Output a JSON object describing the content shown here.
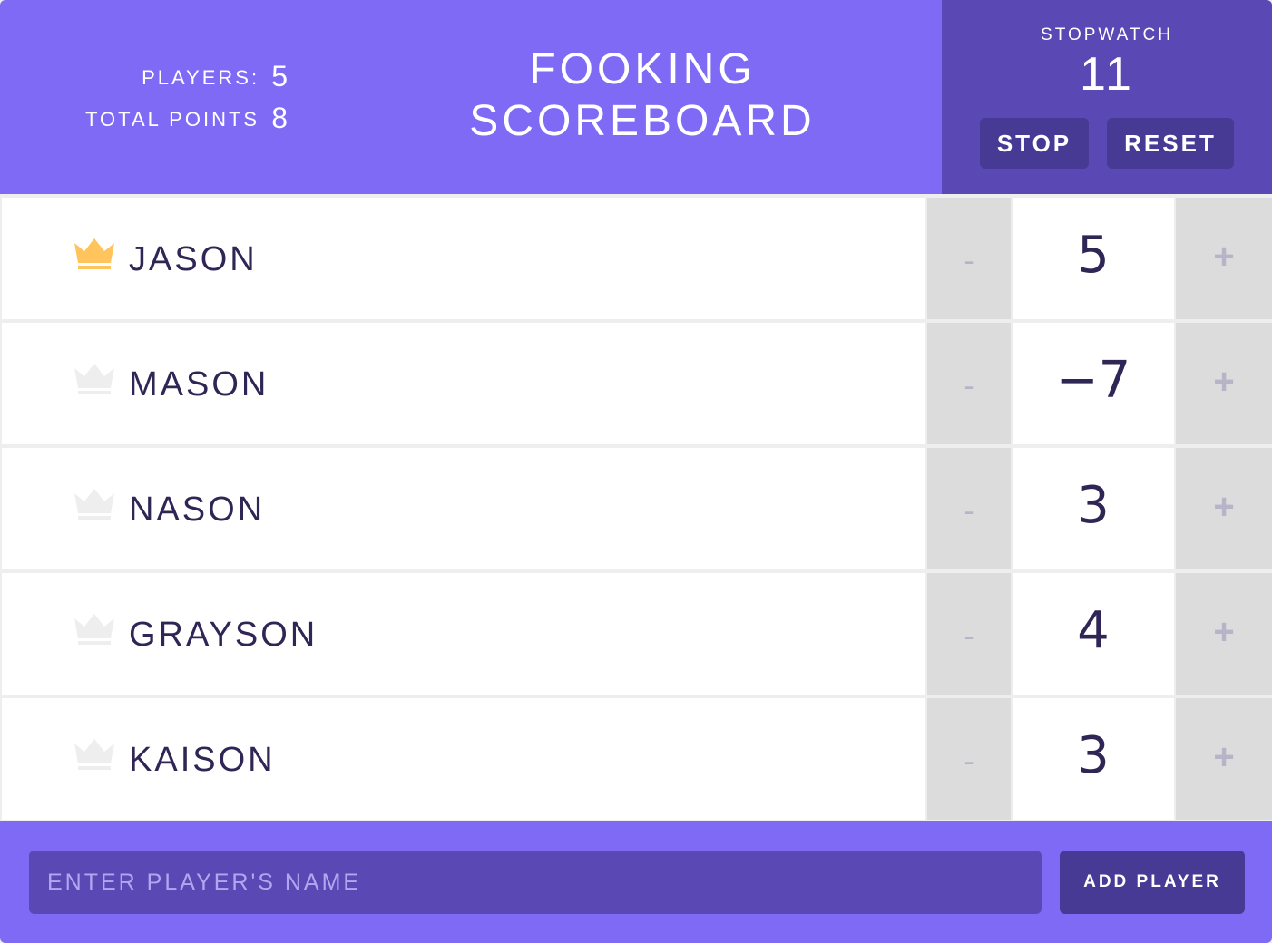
{
  "header": {
    "players_label": "PLAYERS:",
    "players_count": "5",
    "points_label": "TOTAL POINTS",
    "points_total": "8",
    "title_line1": "FOOKING",
    "title_line2": "SCOREBOARD"
  },
  "stopwatch": {
    "label": "STOPWATCH",
    "time": "11",
    "stop_label": "STOP",
    "reset_label": "RESET"
  },
  "players": [
    {
      "name": "JASON",
      "score": "5",
      "leader": true,
      "minus": "-",
      "plus": "+"
    },
    {
      "name": "MASON",
      "score": "−7",
      "leader": false,
      "minus": "-",
      "plus": "+"
    },
    {
      "name": "NASON",
      "score": "3",
      "leader": false,
      "minus": "-",
      "plus": "+"
    },
    {
      "name": "GRAYSON",
      "score": "4",
      "leader": false,
      "minus": "-",
      "plus": "+"
    },
    {
      "name": "KAISON",
      "score": "3",
      "leader": false,
      "minus": "-",
      "plus": "+"
    }
  ],
  "add_form": {
    "placeholder": "ENTER PLAYER'S NAME",
    "button_label": "ADD PLAYER"
  },
  "icons": {
    "crown": "crown-icon"
  },
  "colors": {
    "header_bg": "#7f6af5",
    "stopwatch_bg": "#5a48b5",
    "button_bg": "#463a95",
    "crown_active": "#ffc55c",
    "crown_inactive": "#eeeeee",
    "text_dark": "#2f2655"
  }
}
